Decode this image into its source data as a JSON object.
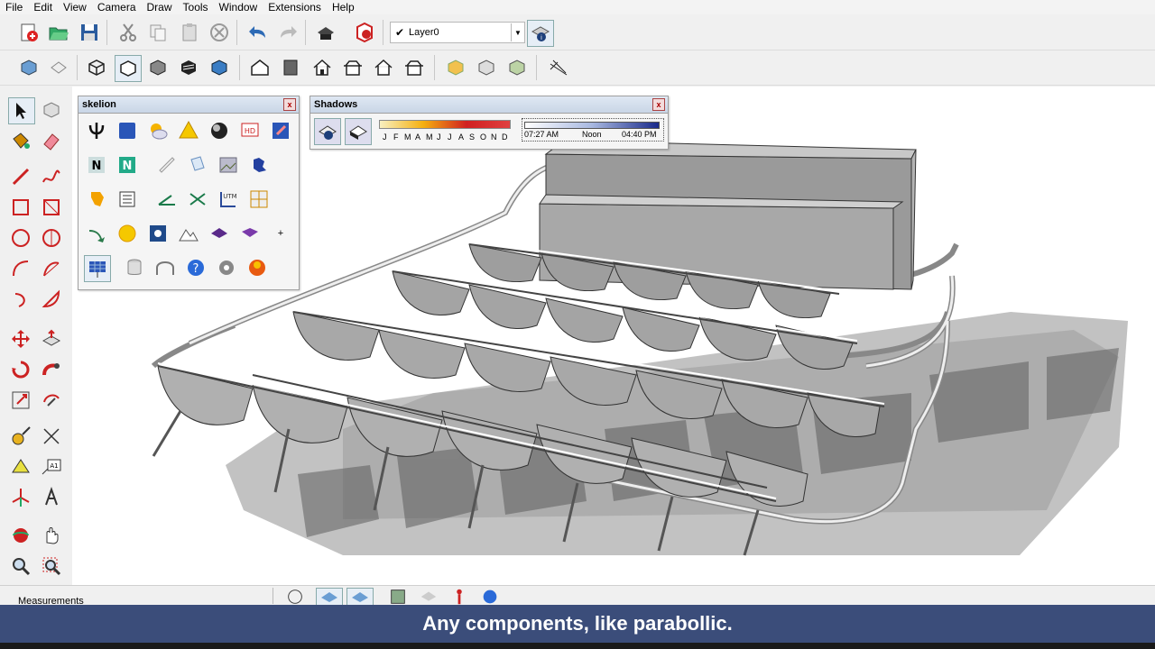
{
  "menu": [
    "File",
    "Edit",
    "View",
    "Camera",
    "Draw",
    "Tools",
    "Window",
    "Extensions",
    "Help"
  ],
  "layer": {
    "check": "✔",
    "name": "Layer0"
  },
  "skelion_panel": {
    "title": "skelion",
    "close": "x"
  },
  "shadows_panel": {
    "title": "Shadows",
    "close": "x",
    "months": [
      "J",
      "F",
      "M",
      "A",
      "M",
      "J",
      "J",
      "A",
      "S",
      "O",
      "N",
      "D"
    ],
    "time_start": "07:27 AM",
    "time_mid": "Noon",
    "time_end": "04:40 PM"
  },
  "status": {
    "measurements_label": "Measurements"
  },
  "caption": "Any components, like parabollic.",
  "colors": {
    "caption_bg": "#3b4d7a",
    "title_bar": "#c9d6e6",
    "model_gray": "#9a9a9a",
    "shadow_gray": "#7a7a7a"
  }
}
